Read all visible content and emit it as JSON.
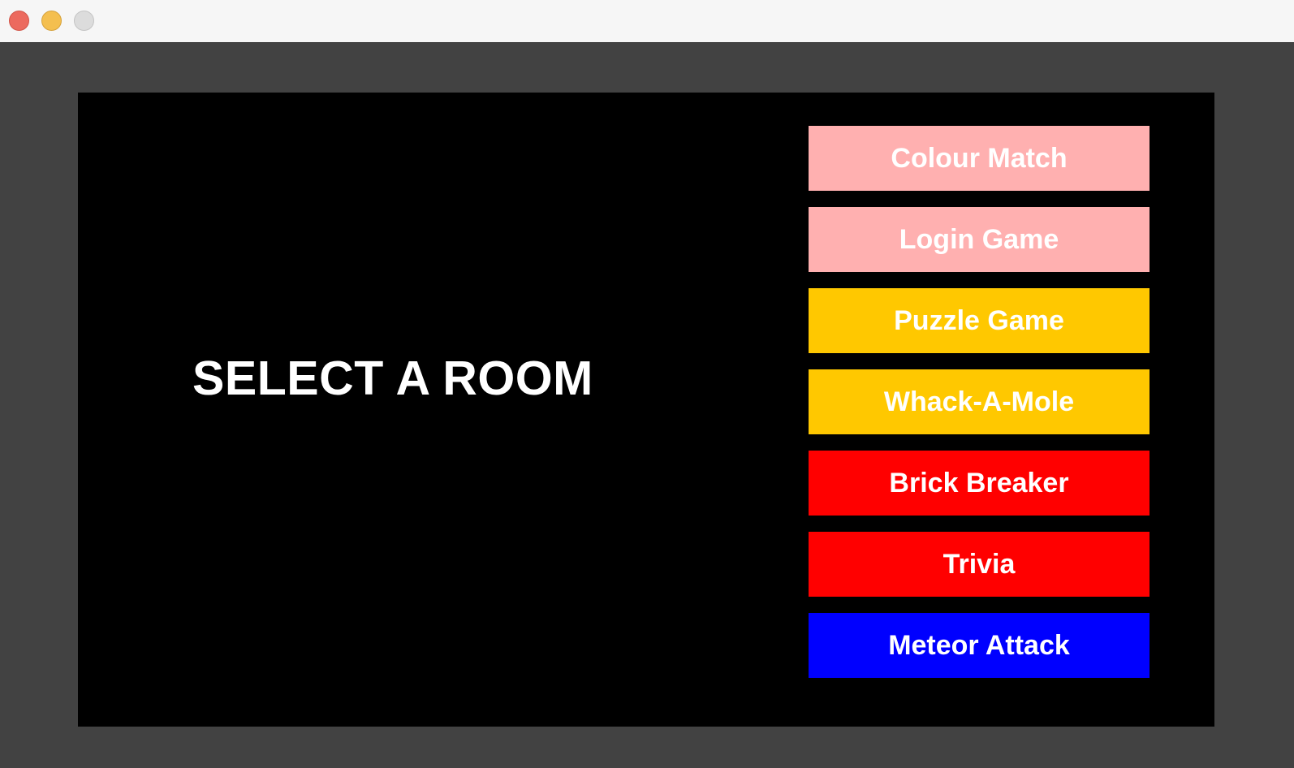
{
  "window": {
    "controls": [
      "close",
      "minimize",
      "zoom"
    ]
  },
  "screen": {
    "title": "SELECT A ROOM"
  },
  "rooms": [
    {
      "label": "Colour Match",
      "color": "#ffb0b0"
    },
    {
      "label": "Login Game",
      "color": "#ffb0b0"
    },
    {
      "label": "Puzzle Game",
      "color": "#ffc800"
    },
    {
      "label": "Whack-A-Mole",
      "color": "#ffc800"
    },
    {
      "label": "Brick Breaker",
      "color": "#ff0000"
    },
    {
      "label": "Trivia",
      "color": "#ff0000"
    },
    {
      "label": "Meteor Attack",
      "color": "#0000ff"
    }
  ]
}
